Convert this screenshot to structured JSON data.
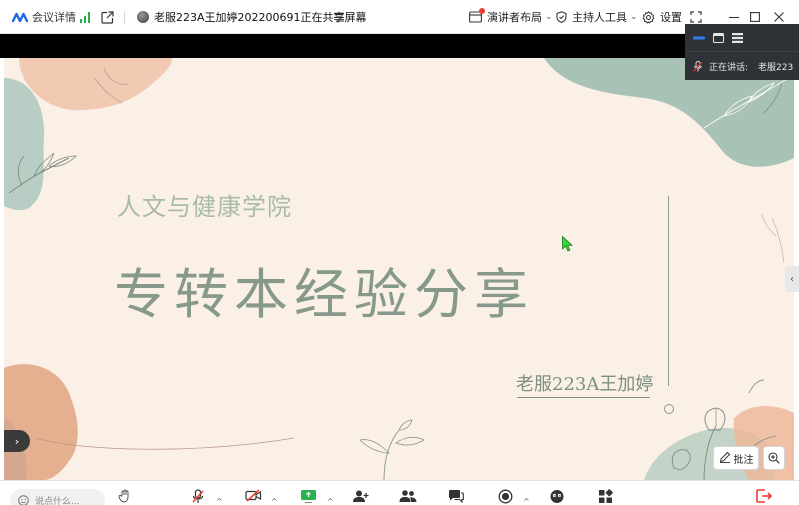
{
  "topbar": {
    "meeting_info": "会议详情",
    "share_title": "老服223A王加婷202200691正在共享屏幕",
    "layout_label": "演讲者布局",
    "host_tools_label": "主持人工具",
    "settings_label": "设置"
  },
  "slide": {
    "subtitle": "人文与健康学院",
    "title": "专转本经验分享",
    "author": "老服223A王加婷"
  },
  "speaker_panel": {
    "speaking_label": "正在讲话:",
    "speaker_name": "老服223"
  },
  "annotate_label": "批注",
  "chat": {
    "placeholder": "说点什么..."
  },
  "colors": {
    "accent": "#2f7cf6",
    "slide_bg": "#fbf0e6",
    "sage": "#a9c2b6",
    "peach": "#e9b190",
    "danger": "#ee3b2b"
  }
}
